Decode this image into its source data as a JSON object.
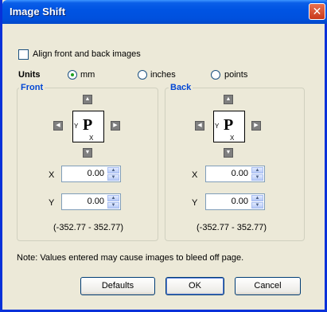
{
  "window": {
    "title": "Image Shift",
    "close_glyph": "✕"
  },
  "align": {
    "label": "Align front and back images",
    "checked": false
  },
  "units": {
    "label": "Units",
    "options": [
      {
        "label": "mm",
        "selected": true
      },
      {
        "label": "inches",
        "selected": false
      },
      {
        "label": "points",
        "selected": false
      }
    ]
  },
  "front": {
    "label": "Front",
    "page_letter": "P",
    "x_label": "X",
    "y_label": "Y",
    "axis_x": "X",
    "axis_y": "Y",
    "x_value": "0.00",
    "y_value": "0.00",
    "range": "(-352.77 - 352.77)"
  },
  "back": {
    "label": "Back",
    "page_letter": "P",
    "x_label": "X",
    "y_label": "Y",
    "axis_x": "X",
    "axis_y": "Y",
    "x_value": "0.00",
    "y_value": "0.00",
    "range": "(-352.77 - 352.77)"
  },
  "note": "Note:  Values entered may cause images to bleed off page.",
  "buttons": {
    "defaults": "Defaults",
    "ok": "OK",
    "cancel": "Cancel"
  },
  "icons": {
    "up": "▲",
    "down": "▼",
    "left": "◀",
    "right": "▶",
    "spin_up": "▲",
    "spin_down": "▼"
  },
  "colors": {
    "title_bar": "#0054e3",
    "group_label": "#0046d5",
    "face": "#ece9d8"
  }
}
